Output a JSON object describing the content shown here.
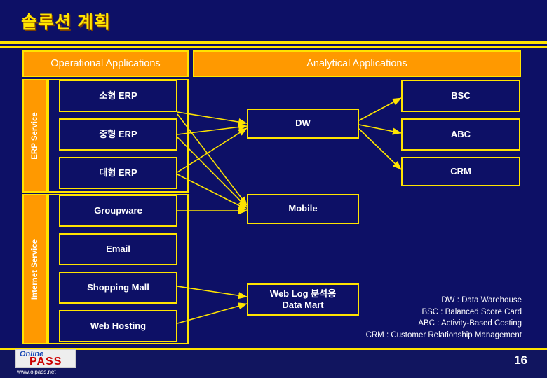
{
  "slide": {
    "title": "솔루션 계획",
    "page_number": "16"
  },
  "headers": [
    {
      "label": "Operational Applications"
    },
    {
      "label": "Analytical Applications"
    }
  ],
  "side_labels": [
    {
      "label": "ERP Service"
    },
    {
      "label": "Internet Service"
    }
  ],
  "operational_boxes": [
    {
      "label": "소형 ERP"
    },
    {
      "label": "중형  ERP"
    },
    {
      "label": "대형 ERP"
    },
    {
      "label": "Groupware"
    },
    {
      "label": "Email"
    },
    {
      "label": "Shopping Mall"
    },
    {
      "label": "Web Hosting"
    }
  ],
  "middle_boxes": [
    {
      "label": "DW"
    },
    {
      "label": "Mobile"
    },
    {
      "label": "Web Log 분석용\nData Mart"
    }
  ],
  "analytical_boxes": [
    {
      "label": "BSC"
    },
    {
      "label": "ABC"
    },
    {
      "label": "CRM"
    }
  ],
  "legend": [
    {
      "line": "DW : Data Warehouse"
    },
    {
      "line": "BSC : Balanced Score Card"
    },
    {
      "line": "ABC : Activity-Based Costing"
    },
    {
      "line": "CRM : Customer Relationship Management"
    }
  ],
  "logo": {
    "word_online": "Online",
    "word_pass": "PASS",
    "url": "www.olpass.net"
  },
  "colors": {
    "background": "#0d1066",
    "accent_yellow": "#ffe400",
    "accent_orange": "#ff9900",
    "text_white": "#ffffff"
  }
}
